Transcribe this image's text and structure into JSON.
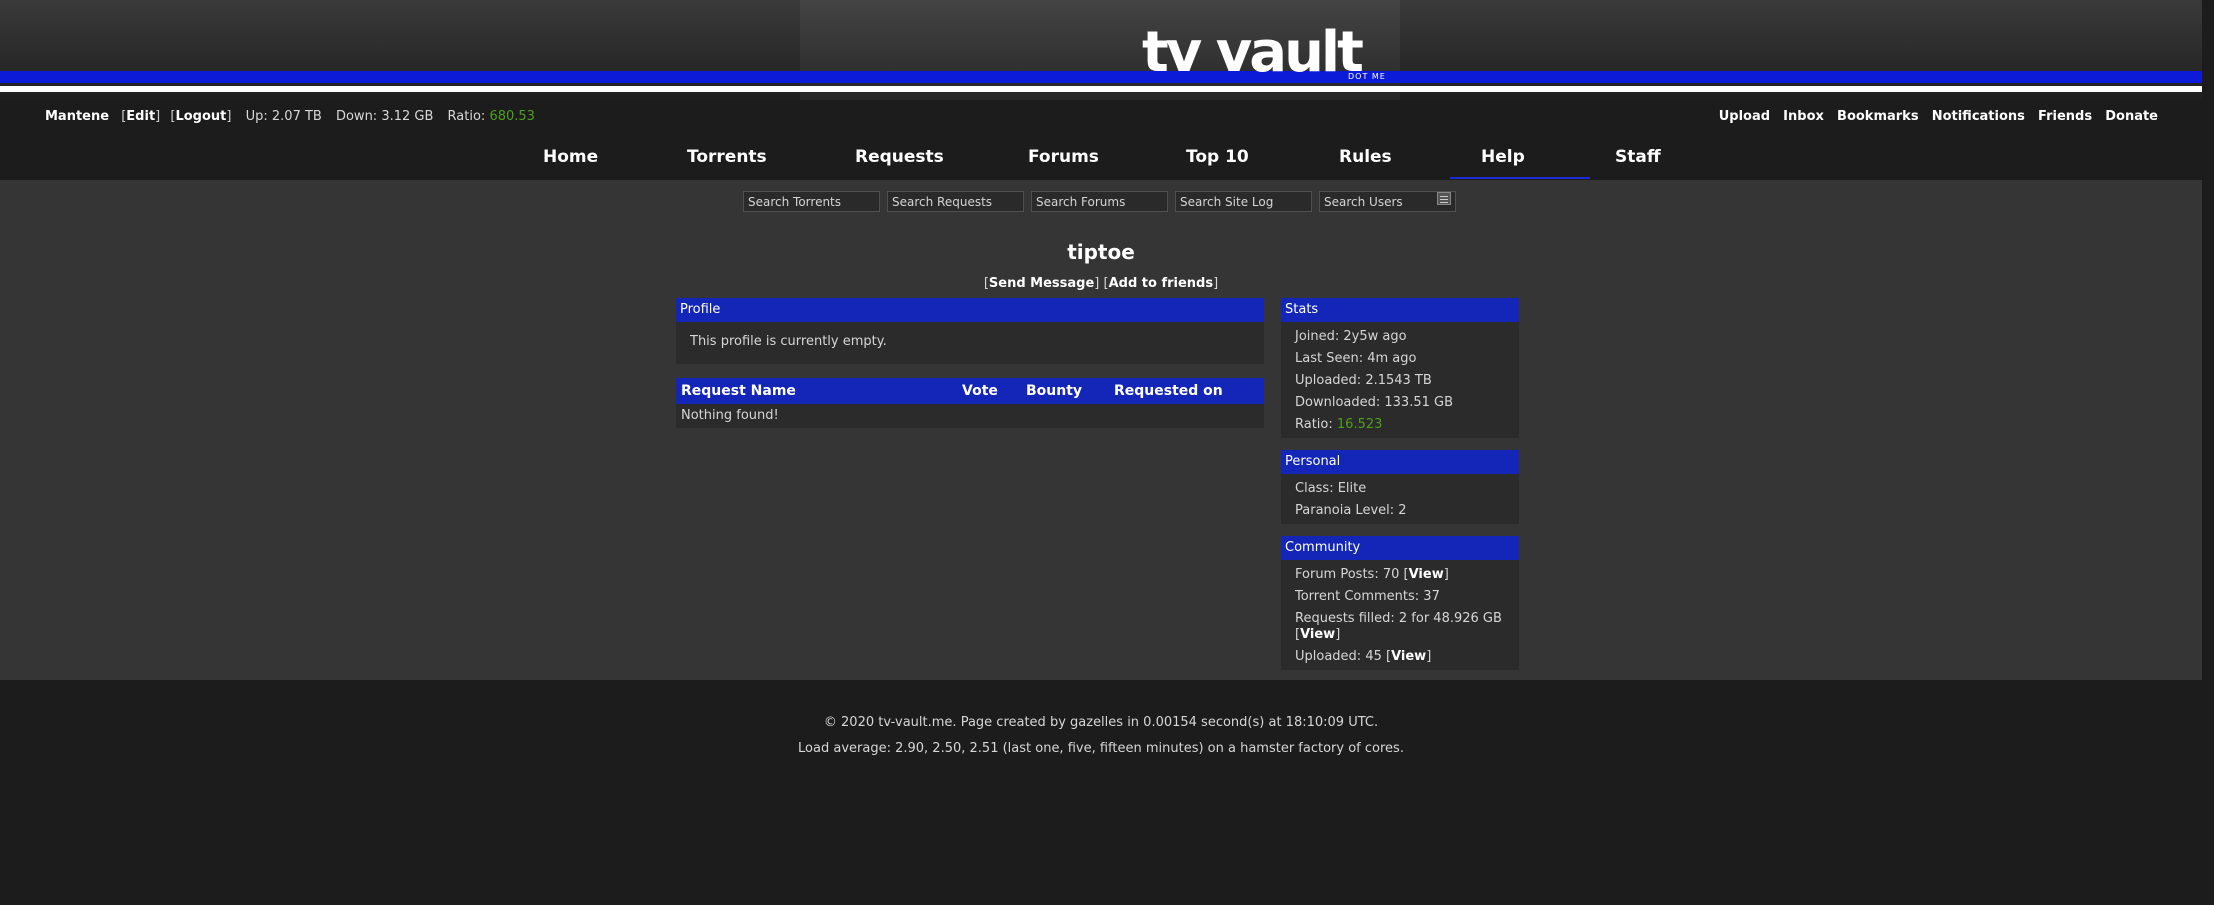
{
  "header": {
    "logo": "tv vault",
    "logo_sub": "DOT ME"
  },
  "user": {
    "name": "Mantene",
    "edit": "Edit",
    "logout": "Logout",
    "up_label": "Up:",
    "up_value": "2.07 TB",
    "down_label": "Down:",
    "down_value": "3.12 GB",
    "ratio_label": "Ratio:",
    "ratio_value": "680.53"
  },
  "usermenu": [
    "Upload",
    "Inbox",
    "Bookmarks",
    "Notifications",
    "Friends",
    "Donate"
  ],
  "nav": [
    "Home",
    "Torrents",
    "Requests",
    "Forums",
    "Top 10",
    "Rules",
    "Help",
    "Staff"
  ],
  "search": {
    "torrents": "Search Torrents",
    "requests": "Search Requests",
    "forums": "Search Forums",
    "log": "Search Site Log",
    "users": "Search Users"
  },
  "profile_user": "tiptoe",
  "links": {
    "send": "Send Message",
    "add": "Add to friends"
  },
  "profile": {
    "title": "Profile",
    "text": "This profile is currently empty."
  },
  "requests": {
    "cols": [
      "Request Name",
      "Vote",
      "Bounty",
      "Requested on"
    ],
    "empty": "Nothing found!"
  },
  "stats": {
    "title": "Stats",
    "joined": "Joined: 2y5w ago",
    "last_seen": "Last Seen: 4m ago",
    "uploaded": "Uploaded: 2.1543 TB",
    "downloaded": "Downloaded: 133.51 GB",
    "ratio_label": "Ratio:",
    "ratio_value": "16.523"
  },
  "personal": {
    "title": "Personal",
    "class": "Class: Elite",
    "paranoia": "Paranoia Level: 2"
  },
  "community": {
    "title": "Community",
    "forum_posts": "Forum Posts: 70",
    "torrent_comments": "Torrent Comments: 37",
    "requests_filled": "Requests filled: 2 for 48.926 GB",
    "uploaded": "Uploaded: 45",
    "view": "View"
  },
  "footer": {
    "line1": "© 2020 tv-vault.me.  Page created by gazelles in 0.00154 second(s) at 18:10:09 UTC.",
    "line2": "Load average: 2.90, 2.50, 2.51 (last one, five, fifteen minutes) on a hamster factory of cores."
  },
  "colors": {
    "accent": "#1326b7",
    "stripe": "#0b1bd8",
    "ratio": "#4e9f1e"
  }
}
